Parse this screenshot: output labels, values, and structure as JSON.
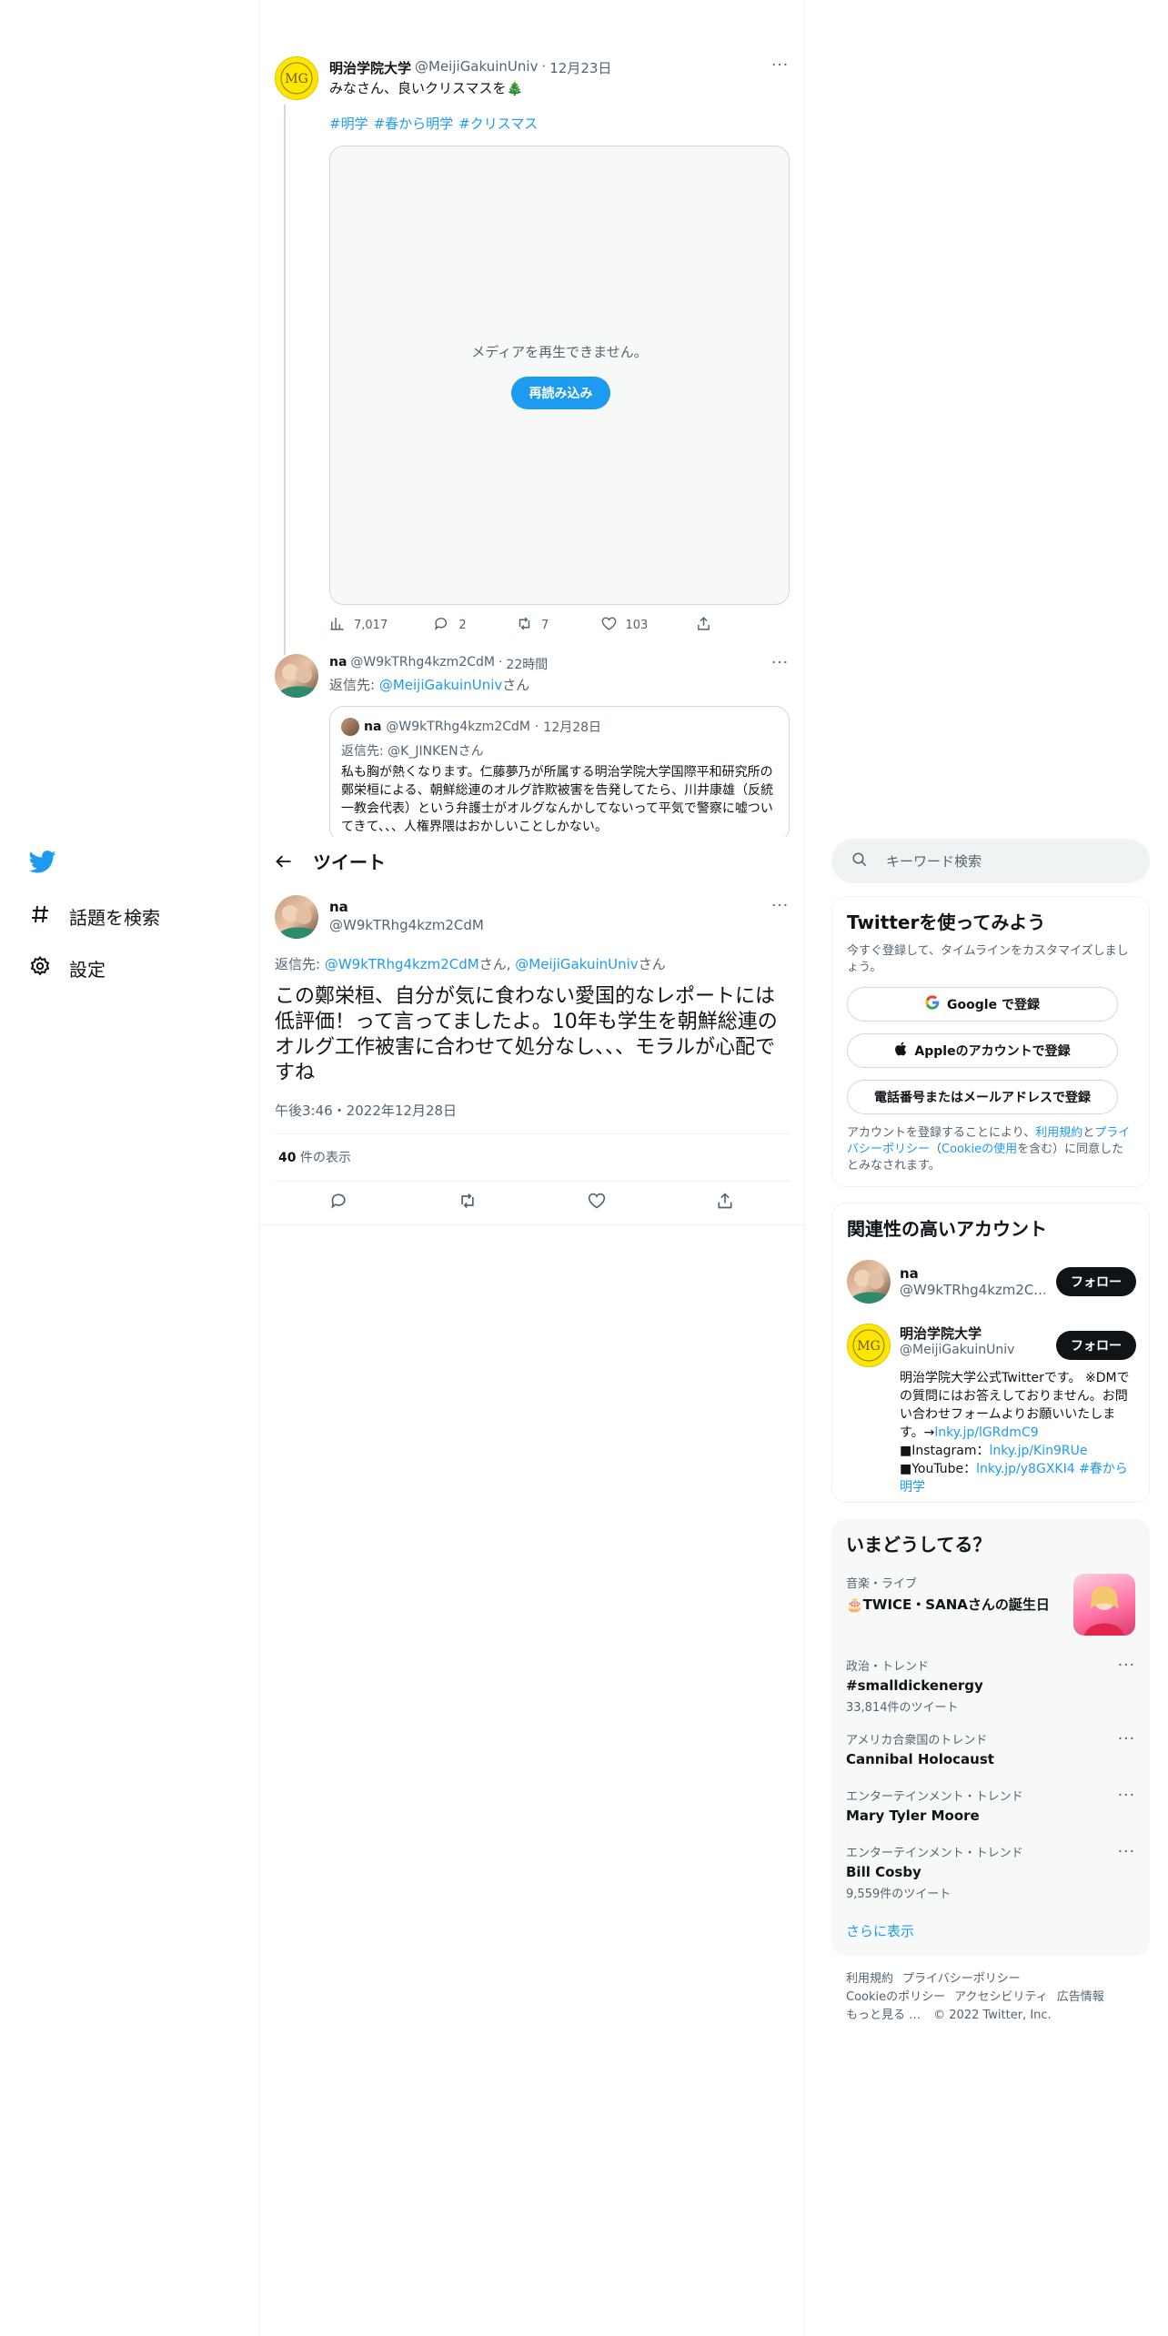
{
  "nav": {
    "explore_label": "話題を検索",
    "settings_label": "設定"
  },
  "tweet1": {
    "author_name": "明治学院大学",
    "handle": "@MeijiGakuinUniv",
    "date": "12月23日",
    "text": "みなさん、良いクリスマスを🎄",
    "hashtags": [
      "#明学",
      "#春から明学",
      "#クリスマス"
    ],
    "media_message": "メディアを再生できません。",
    "reload_label": "再読み込み",
    "views": "7,017",
    "replies": "2",
    "retweets": "7",
    "likes": "103"
  },
  "tweet2": {
    "author_name": "na",
    "handle": "@W9kTRhg4kzm2CdM",
    "time": "22時間",
    "reply_to_label": "返信先: ",
    "reply_to_handle": "@MeijiGakuinUniv",
    "reply_to_suffix": "さん",
    "quote": {
      "author_name": "na",
      "handle": "@W9kTRhg4kzm2CdM",
      "date": "12月28日",
      "reply_to_label": "返信先: ",
      "reply_to_handle": "@K_JINKEN",
      "reply_to_suffix": "さん",
      "text": "私も胸が熱くなります。仁藤夢乃が所属する明治学院大学国際平和研究所の鄭栄桓による、朝鮮総連のオルグ詐欺被害を告発してたら、川井康雄（反統一教会代表）という弁護士がオルグなんかしてないって平気で警察に嘘ついてきて、、、人権界隈はおかしいことしかない。"
    }
  },
  "header": {
    "title": "ツイート"
  },
  "main_tweet": {
    "author_name": "na",
    "handle": "@W9kTRhg4kzm2CdM",
    "reply_to_label": "返信先: ",
    "reply_to_handle1": "@W9kTRhg4kzm2CdM",
    "reply_to_mid": "さん, ",
    "reply_to_handle2": "@MeijiGakuinUniv",
    "reply_to_suffix": "さん",
    "text": "この鄭栄桓、自分が気に食わない愛国的なレポートには低評価！って言ってましたよ。10年も学生を朝鮮総連のオルグ工作被害に合わせて処分なし、、、モラルが心配ですね",
    "timestamp": "午後3:46・2022年12月28日",
    "views_count": "40",
    "views_label": " 件の表示"
  },
  "sidebar": {
    "search_placeholder": "キーワード検索",
    "signup": {
      "title": "Twitterを使ってみよう",
      "subtitle": "今すぐ登録して、タイムラインをカスタマイズしましょう。",
      "google_label": "Google で登録",
      "apple_label": "Appleのアカウントで登録",
      "phone_label": "電話番号またはメールアドレスで登録",
      "terms_prefix": "アカウントを登録することにより、",
      "terms_link": "利用規約",
      "terms_and": "と",
      "privacy_link": "プライバシーポリシー",
      "cookie_open": "（",
      "cookie_link": "Cookieの使用",
      "terms_suffix": "を含む）に同意したとみなされます。"
    },
    "related": {
      "title": "関連性の高いアカウント",
      "follow_label": "フォロー",
      "accounts": [
        {
          "name": "na",
          "handle": "@W9kTRhg4kzm2C..."
        },
        {
          "name": "明治学院大学",
          "handle": "@MeijiGakuinUniv",
          "bio1": "明治学院大学公式Twitterです。 ※DMでの質問にはお答えしておりません。お問い合わせフォームよりお願いいたします。→",
          "bio_link1": "lnky.jp/lGRdmC9",
          "bio2": "■Instagram：",
          "bio_link2": "lnky.jp/Kin9RUe",
          "bio3": "■YouTube：",
          "bio_link3": "lnky.jp/y8GXKI4",
          "bio_tag1": " #春から",
          "bio_tag2": "明学"
        }
      ]
    },
    "trends": {
      "title": "いまどうしてる？",
      "items": [
        {
          "category": "音楽・ライブ",
          "name": "🎂TWICE・SANAさんの誕生日",
          "count": ""
        },
        {
          "category": "政治・トレンド",
          "name": "#smalldickenergy",
          "count": "33,814件のツイート"
        },
        {
          "category": "アメリカ合衆国のトレンド",
          "name": "Cannibal Holocaust",
          "count": ""
        },
        {
          "category": "エンターテインメント・トレンド",
          "name": "Mary Tyler Moore",
          "count": ""
        },
        {
          "category": "エンターテインメント・トレンド",
          "name": "Bill Cosby",
          "count": "9,559件のツイート"
        }
      ],
      "show_more": "さらに表示"
    },
    "footer": {
      "terms": "利用規約",
      "privacy": "プライバシーポリシー",
      "cookie": "Cookieのポリシー",
      "accessibility": "アクセシビリティ",
      "ads": "広告情報",
      "more": "もっと見る …",
      "copyright": "© 2022 Twitter, Inc."
    }
  }
}
